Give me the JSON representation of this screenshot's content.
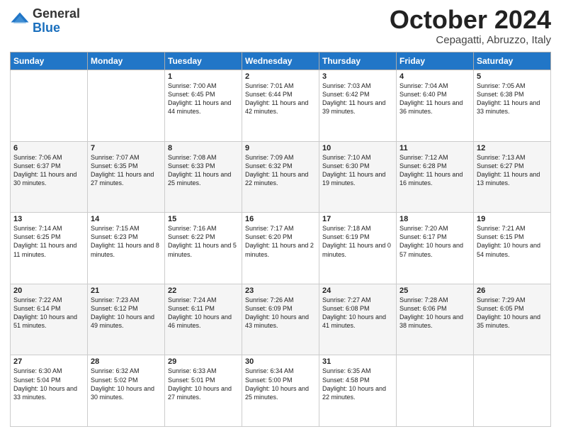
{
  "header": {
    "logo_general": "General",
    "logo_blue": "Blue",
    "month_title": "October 2024",
    "location": "Cepagatti, Abruzzo, Italy"
  },
  "days_of_week": [
    "Sunday",
    "Monday",
    "Tuesday",
    "Wednesday",
    "Thursday",
    "Friday",
    "Saturday"
  ],
  "weeks": [
    [
      {
        "day": "",
        "sunrise": "",
        "sunset": "",
        "daylight": ""
      },
      {
        "day": "",
        "sunrise": "",
        "sunset": "",
        "daylight": ""
      },
      {
        "day": "1",
        "sunrise": "Sunrise: 7:00 AM",
        "sunset": "Sunset: 6:45 PM",
        "daylight": "Daylight: 11 hours and 44 minutes."
      },
      {
        "day": "2",
        "sunrise": "Sunrise: 7:01 AM",
        "sunset": "Sunset: 6:44 PM",
        "daylight": "Daylight: 11 hours and 42 minutes."
      },
      {
        "day": "3",
        "sunrise": "Sunrise: 7:03 AM",
        "sunset": "Sunset: 6:42 PM",
        "daylight": "Daylight: 11 hours and 39 minutes."
      },
      {
        "day": "4",
        "sunrise": "Sunrise: 7:04 AM",
        "sunset": "Sunset: 6:40 PM",
        "daylight": "Daylight: 11 hours and 36 minutes."
      },
      {
        "day": "5",
        "sunrise": "Sunrise: 7:05 AM",
        "sunset": "Sunset: 6:38 PM",
        "daylight": "Daylight: 11 hours and 33 minutes."
      }
    ],
    [
      {
        "day": "6",
        "sunrise": "Sunrise: 7:06 AM",
        "sunset": "Sunset: 6:37 PM",
        "daylight": "Daylight: 11 hours and 30 minutes."
      },
      {
        "day": "7",
        "sunrise": "Sunrise: 7:07 AM",
        "sunset": "Sunset: 6:35 PM",
        "daylight": "Daylight: 11 hours and 27 minutes."
      },
      {
        "day": "8",
        "sunrise": "Sunrise: 7:08 AM",
        "sunset": "Sunset: 6:33 PM",
        "daylight": "Daylight: 11 hours and 25 minutes."
      },
      {
        "day": "9",
        "sunrise": "Sunrise: 7:09 AM",
        "sunset": "Sunset: 6:32 PM",
        "daylight": "Daylight: 11 hours and 22 minutes."
      },
      {
        "day": "10",
        "sunrise": "Sunrise: 7:10 AM",
        "sunset": "Sunset: 6:30 PM",
        "daylight": "Daylight: 11 hours and 19 minutes."
      },
      {
        "day": "11",
        "sunrise": "Sunrise: 7:12 AM",
        "sunset": "Sunset: 6:28 PM",
        "daylight": "Daylight: 11 hours and 16 minutes."
      },
      {
        "day": "12",
        "sunrise": "Sunrise: 7:13 AM",
        "sunset": "Sunset: 6:27 PM",
        "daylight": "Daylight: 11 hours and 13 minutes."
      }
    ],
    [
      {
        "day": "13",
        "sunrise": "Sunrise: 7:14 AM",
        "sunset": "Sunset: 6:25 PM",
        "daylight": "Daylight: 11 hours and 11 minutes."
      },
      {
        "day": "14",
        "sunrise": "Sunrise: 7:15 AM",
        "sunset": "Sunset: 6:23 PM",
        "daylight": "Daylight: 11 hours and 8 minutes."
      },
      {
        "day": "15",
        "sunrise": "Sunrise: 7:16 AM",
        "sunset": "Sunset: 6:22 PM",
        "daylight": "Daylight: 11 hours and 5 minutes."
      },
      {
        "day": "16",
        "sunrise": "Sunrise: 7:17 AM",
        "sunset": "Sunset: 6:20 PM",
        "daylight": "Daylight: 11 hours and 2 minutes."
      },
      {
        "day": "17",
        "sunrise": "Sunrise: 7:18 AM",
        "sunset": "Sunset: 6:19 PM",
        "daylight": "Daylight: 11 hours and 0 minutes."
      },
      {
        "day": "18",
        "sunrise": "Sunrise: 7:20 AM",
        "sunset": "Sunset: 6:17 PM",
        "daylight": "Daylight: 10 hours and 57 minutes."
      },
      {
        "day": "19",
        "sunrise": "Sunrise: 7:21 AM",
        "sunset": "Sunset: 6:15 PM",
        "daylight": "Daylight: 10 hours and 54 minutes."
      }
    ],
    [
      {
        "day": "20",
        "sunrise": "Sunrise: 7:22 AM",
        "sunset": "Sunset: 6:14 PM",
        "daylight": "Daylight: 10 hours and 51 minutes."
      },
      {
        "day": "21",
        "sunrise": "Sunrise: 7:23 AM",
        "sunset": "Sunset: 6:12 PM",
        "daylight": "Daylight: 10 hours and 49 minutes."
      },
      {
        "day": "22",
        "sunrise": "Sunrise: 7:24 AM",
        "sunset": "Sunset: 6:11 PM",
        "daylight": "Daylight: 10 hours and 46 minutes."
      },
      {
        "day": "23",
        "sunrise": "Sunrise: 7:26 AM",
        "sunset": "Sunset: 6:09 PM",
        "daylight": "Daylight: 10 hours and 43 minutes."
      },
      {
        "day": "24",
        "sunrise": "Sunrise: 7:27 AM",
        "sunset": "Sunset: 6:08 PM",
        "daylight": "Daylight: 10 hours and 41 minutes."
      },
      {
        "day": "25",
        "sunrise": "Sunrise: 7:28 AM",
        "sunset": "Sunset: 6:06 PM",
        "daylight": "Daylight: 10 hours and 38 minutes."
      },
      {
        "day": "26",
        "sunrise": "Sunrise: 7:29 AM",
        "sunset": "Sunset: 6:05 PM",
        "daylight": "Daylight: 10 hours and 35 minutes."
      }
    ],
    [
      {
        "day": "27",
        "sunrise": "Sunrise: 6:30 AM",
        "sunset": "Sunset: 5:04 PM",
        "daylight": "Daylight: 10 hours and 33 minutes."
      },
      {
        "day": "28",
        "sunrise": "Sunrise: 6:32 AM",
        "sunset": "Sunset: 5:02 PM",
        "daylight": "Daylight: 10 hours and 30 minutes."
      },
      {
        "day": "29",
        "sunrise": "Sunrise: 6:33 AM",
        "sunset": "Sunset: 5:01 PM",
        "daylight": "Daylight: 10 hours and 27 minutes."
      },
      {
        "day": "30",
        "sunrise": "Sunrise: 6:34 AM",
        "sunset": "Sunset: 5:00 PM",
        "daylight": "Daylight: 10 hours and 25 minutes."
      },
      {
        "day": "31",
        "sunrise": "Sunrise: 6:35 AM",
        "sunset": "Sunset: 4:58 PM",
        "daylight": "Daylight: 10 hours and 22 minutes."
      },
      {
        "day": "",
        "sunrise": "",
        "sunset": "",
        "daylight": ""
      },
      {
        "day": "",
        "sunrise": "",
        "sunset": "",
        "daylight": ""
      }
    ]
  ]
}
